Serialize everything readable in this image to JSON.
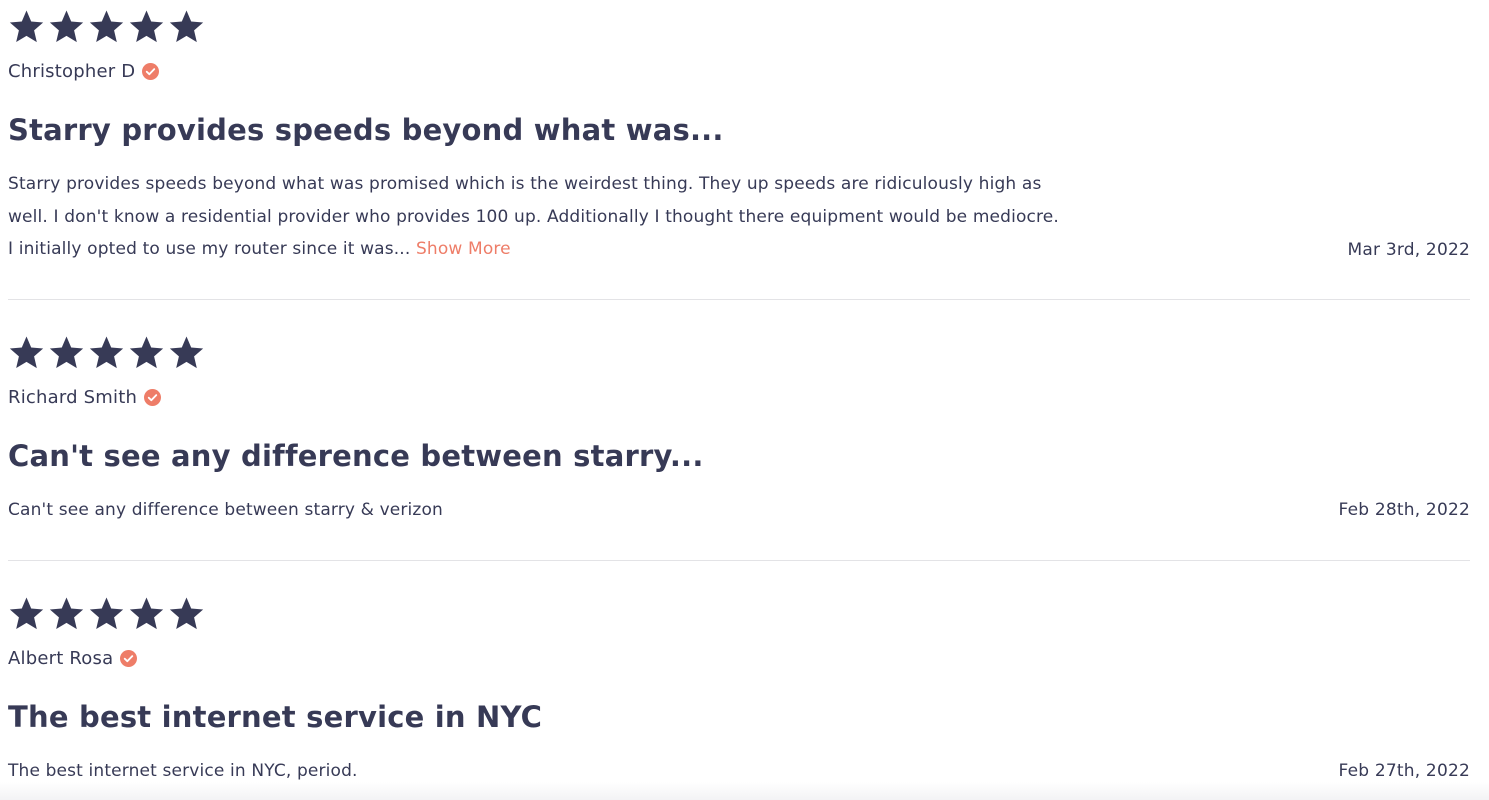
{
  "colors": {
    "text": "#373a56",
    "star": "#373a56",
    "accent": "#ee7d68",
    "divider": "#e3e3e6"
  },
  "icons": {
    "star": "star-icon",
    "verified": "verified-check-icon"
  },
  "reviews": [
    {
      "rating": 5,
      "author": "Christopher D",
      "verified": true,
      "title": "Starry provides speeds beyond what was...",
      "body": "Starry provides speeds beyond what was promised which is the weirdest thing. They up speeds are ridiculously high as well. I don't know a residential provider who provides 100 up. Additionally I thought there equipment would be mediocre. I initially opted to use my router since it was...",
      "show_more": "Show More",
      "date": "Mar 3rd, 2022"
    },
    {
      "rating": 5,
      "author": "Richard Smith",
      "verified": true,
      "title": "Can't see any difference between starry...",
      "body": "Can't see any difference between starry & verizon",
      "date": "Feb 28th, 2022"
    },
    {
      "rating": 5,
      "author": "Albert Rosa",
      "verified": true,
      "title": "The best internet service in NYC",
      "body": "The best internet service in NYC, period.",
      "date": "Feb 27th, 2022"
    }
  ]
}
